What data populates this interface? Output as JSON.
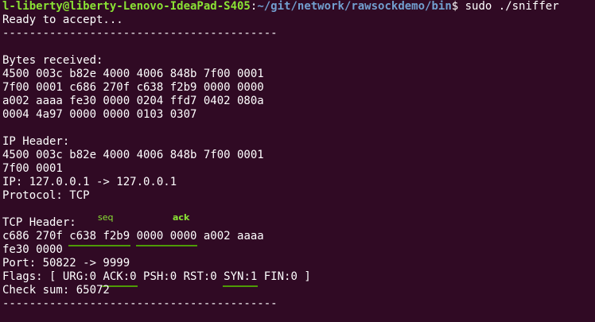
{
  "prompt": {
    "user_host": "l-liberty@liberty-Lenovo-IdeaPad-S405",
    "colon": ":",
    "path": "~/git/network/rawsockdemo/bin",
    "dollar": "$",
    "command": " sudo ./sniffer"
  },
  "lines": {
    "ready": "Ready to accept...",
    "separator": "-----------------------------------------",
    "bytes_header": "Bytes received:",
    "bytes_row1": "4500 003c b82e 4000 4006 848b 7f00 0001",
    "bytes_row2": "7f00 0001 c686 270f c638 f2b9 0000 0000",
    "bytes_row3": "a002 aaaa fe30 0000 0204 ffd7 0402 080a",
    "bytes_row4": "0004 4a97 0000 0000 0103 0307",
    "ip_header": "IP Header:",
    "ip_row1": "4500 003c b82e 4000 4006 848b 7f00 0001",
    "ip_row2": "7f00 0001",
    "ip_addr": "IP: 127.0.0.1 -> 127.0.0.1",
    "protocol": "Protocol: TCP",
    "tcp_header": "TCP Header:",
    "tcp_row1_a": "c686 270f ",
    "tcp_row1_seq": "c638 f2b9",
    "tcp_row1_sp": " ",
    "tcp_row1_ack": "0000 0000",
    "tcp_row1_b": " a002 aaaa",
    "tcp_row2": "fe30 0000",
    "port": "Port: 50822 -> 9999",
    "flags_a": "Flags: [ URG:0 ",
    "flags_ack": "ACK:0",
    "flags_b": " PSH:0 RST:0 ",
    "flags_syn": "SYN:1",
    "flags_c": " FIN:0 ]",
    "checksum": "Check sum: 65072"
  },
  "annotations": {
    "seq": "seq",
    "ack": "ack",
    "color": "#8ae234"
  }
}
